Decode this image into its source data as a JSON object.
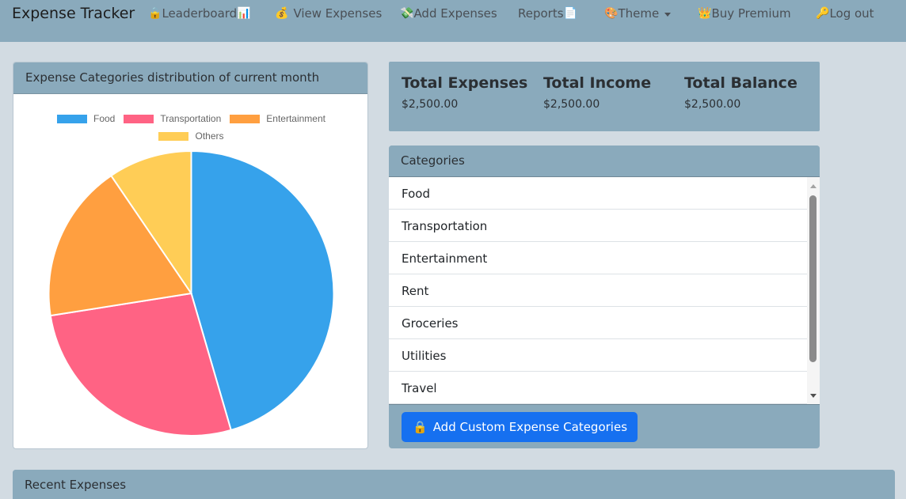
{
  "nav": {
    "brand": "Expense Tracker",
    "leaderboard": {
      "icon": "🔒",
      "label": "Leaderboard",
      "suffix": "📊"
    },
    "view_expenses": {
      "icon": "💰",
      "label": "View Expenses"
    },
    "add_expenses": {
      "icon": "💸",
      "label": "Add Expenses"
    },
    "reports": {
      "label": "Reports",
      "suffix": "📄"
    },
    "theme": {
      "icon": "🎨",
      "label": "Theme"
    },
    "buy_premium": {
      "icon": "👑",
      "label": "Buy Premium"
    },
    "logout": {
      "icon": "🔑",
      "label": "Log out"
    }
  },
  "pie_card": {
    "title": "Expense Categories distribution of current month"
  },
  "chart_data": {
    "type": "pie",
    "categories": [
      "Food",
      "Transportation",
      "Entertainment",
      "Others"
    ],
    "values": [
      45.5,
      27.0,
      18.0,
      9.5
    ],
    "colors": [
      "#36a2eb",
      "#ff6384",
      "#ff9f40",
      "#ffcd56"
    ],
    "legend_position": "top"
  },
  "totals": {
    "expenses_label": "Total Expenses",
    "expenses_value": "$2,500.00",
    "income_label": "Total Income",
    "income_value": "$2,500.00",
    "balance_label": "Total Balance",
    "balance_value": "$2,500.00"
  },
  "categories": {
    "title": "Categories",
    "items": [
      "Food",
      "Transportation",
      "Entertainment",
      "Rent",
      "Groceries",
      "Utilities",
      "Travel"
    ],
    "add_button_icon": "🔒",
    "add_button": "Add Custom Expense Categories"
  },
  "recent": {
    "title": "Recent Expenses"
  }
}
